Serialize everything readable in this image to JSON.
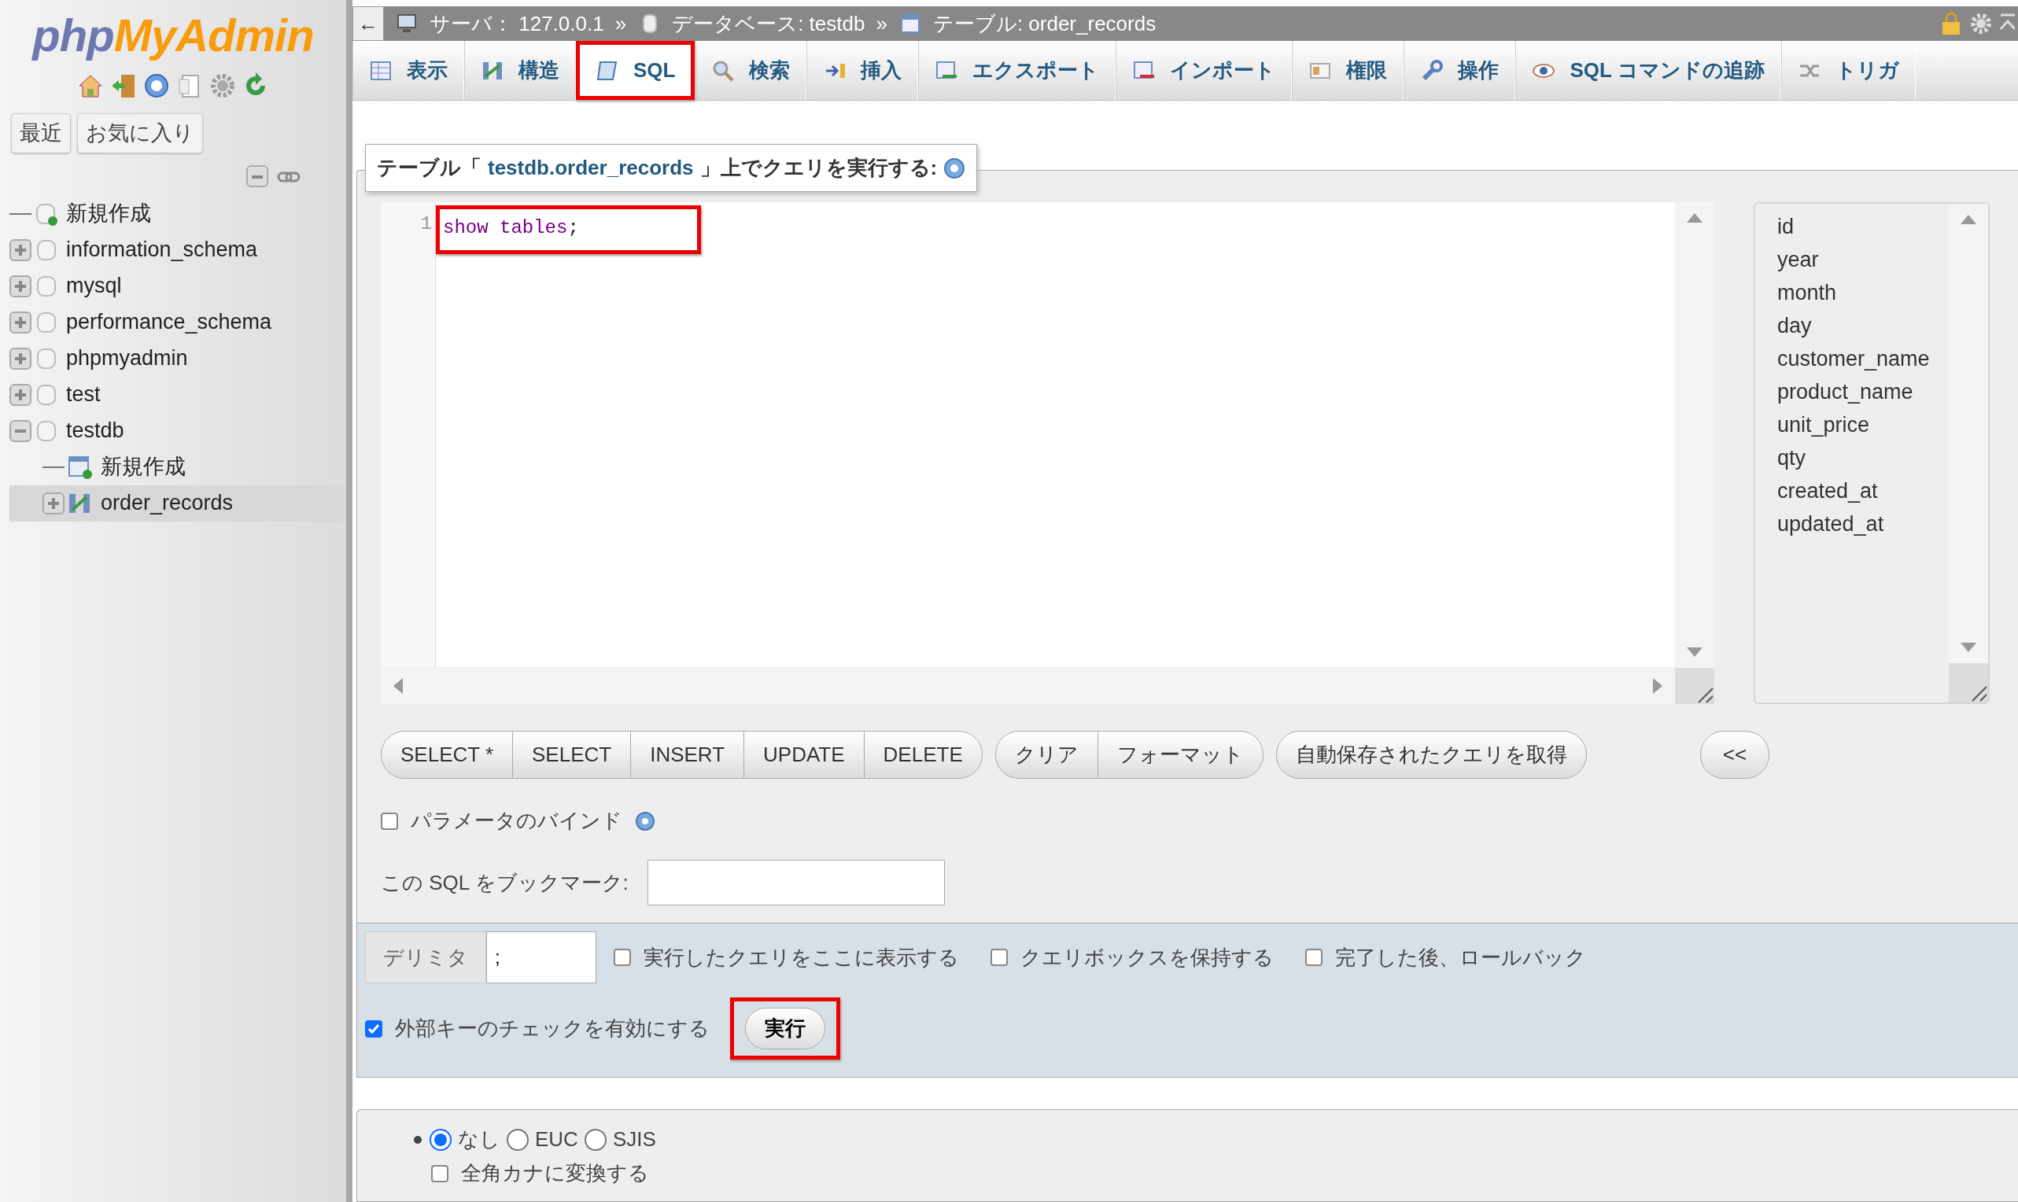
{
  "sidebar": {
    "logo": {
      "part1": "php",
      "part2": "MyAdmin"
    },
    "buttons": [
      "最近",
      "お気に入り"
    ],
    "tree": [
      {
        "label": "新規作成",
        "kind": "new"
      },
      {
        "label": "information_schema",
        "kind": "db",
        "expanded": false
      },
      {
        "label": "mysql",
        "kind": "db",
        "expanded": false
      },
      {
        "label": "performance_schema",
        "kind": "db",
        "expanded": false
      },
      {
        "label": "phpmyadmin",
        "kind": "db",
        "expanded": false
      },
      {
        "label": "test",
        "kind": "db",
        "expanded": false
      },
      {
        "label": "testdb",
        "kind": "db",
        "expanded": true,
        "children": [
          {
            "label": "新規作成",
            "kind": "new-table",
            "selected": false
          },
          {
            "label": "order_records",
            "kind": "table",
            "expanded": false,
            "selected": true
          }
        ]
      }
    ]
  },
  "breadcrumb": [
    {
      "kind": "server",
      "label": "サーバ： 127.0.0.1"
    },
    {
      "kind": "sep",
      "label": "»"
    },
    {
      "kind": "database",
      "label": "データベース: testdb"
    },
    {
      "kind": "sep",
      "label": "»"
    },
    {
      "kind": "table",
      "label": "テーブル: order_records"
    }
  ],
  "back_button": "←",
  "tabs": [
    {
      "label": "表示",
      "selected": false,
      "highlighted": false
    },
    {
      "label": "構造",
      "selected": false,
      "highlighted": false
    },
    {
      "label": "SQL",
      "selected": true,
      "highlighted": true
    },
    {
      "label": "検索",
      "selected": false,
      "highlighted": false
    },
    {
      "label": "挿入",
      "selected": false,
      "highlighted": false
    },
    {
      "label": "エクスポート",
      "selected": false,
      "highlighted": false
    },
    {
      "label": "インポート",
      "selected": false,
      "highlighted": false
    },
    {
      "label": "権限",
      "selected": false,
      "highlighted": false
    },
    {
      "label": "操作",
      "selected": false,
      "highlighted": false
    },
    {
      "label": "SQL コマンドの追跡",
      "selected": false,
      "highlighted": false
    },
    {
      "label": "トリガ",
      "selected": false,
      "highlighted": false
    }
  ],
  "query": {
    "title_prefix": "テーブル「",
    "title_link": "testdb.order_records",
    "title_suffix": "」上でクエリを実行する:",
    "editor": {
      "highlighted": true,
      "lines": [
        {
          "number": "1",
          "tokens": [
            {
              "text": "show tables",
              "kind": "keyword"
            },
            {
              "text": ";",
              "kind": "punct"
            }
          ]
        }
      ]
    },
    "columns": [
      "id",
      "year",
      "month",
      "day",
      "customer_name",
      "product_name",
      "unit_price",
      "qty",
      "created_at",
      "updated_at"
    ],
    "button_groups": [
      [
        "SELECT *",
        "SELECT",
        "INSERT",
        "UPDATE",
        "DELETE"
      ],
      [
        "クリア",
        "フォーマット"
      ],
      [
        "自動保存されたクエリを取得"
      ]
    ],
    "insert_button": "<<",
    "bind_params": {
      "label": "パラメータのバインド",
      "checked": false
    },
    "bookmark_label": "この SQL をブックマーク:"
  },
  "footer": {
    "delimiter_label": "デリミタ",
    "delimiter_value": ";",
    "options": [
      {
        "label": "実行したクエリをここに表示する",
        "checked": false
      },
      {
        "label": "クエリボックスを保持する",
        "checked": false
      },
      {
        "label": "完了した後、ロールバック",
        "checked": false
      },
      {
        "label": "外部キーのチェックを有効にする",
        "checked": true
      }
    ],
    "execute": {
      "label": "実行",
      "highlighted": true
    }
  },
  "charset": {
    "radios": [
      {
        "label": "なし",
        "selected": true
      },
      {
        "label": "EUC",
        "selected": false
      },
      {
        "label": "SJIS",
        "selected": false
      }
    ],
    "convert": {
      "label": "全角カナに変換する",
      "checked": false
    }
  }
}
